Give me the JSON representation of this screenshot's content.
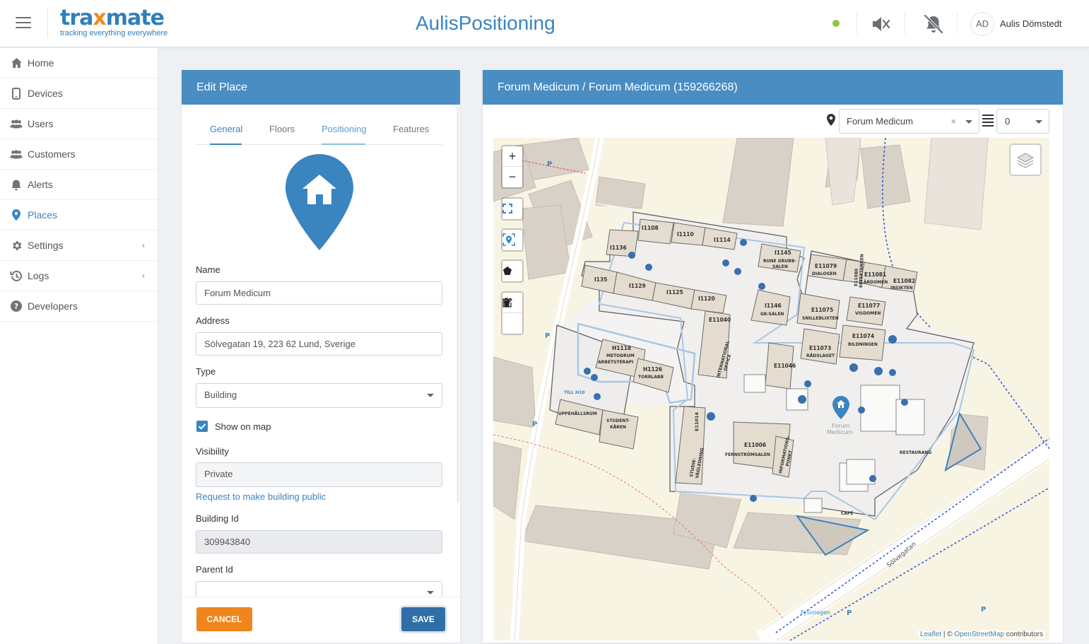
{
  "header": {
    "logo_brand_a": "tra",
    "logo_brand_x": "x",
    "logo_brand_b": "mate",
    "logo_tagline": "tracking everything everywhere",
    "app_title": "AulisPositioning",
    "user_initials": "AD",
    "user_name": "Aulis Dömstedt",
    "status_color": "#8dc63f"
  },
  "sidebar": {
    "items": [
      {
        "label": "Home",
        "icon": "home-icon"
      },
      {
        "label": "Devices",
        "icon": "phone-icon"
      },
      {
        "label": "Users",
        "icon": "users-icon"
      },
      {
        "label": "Customers",
        "icon": "customers-icon"
      },
      {
        "label": "Alerts",
        "icon": "bell-icon"
      },
      {
        "label": "Places",
        "icon": "map-pin-icon",
        "active": true
      },
      {
        "label": "Settings",
        "icon": "gear-icon",
        "expandable": true
      },
      {
        "label": "Logs",
        "icon": "history-icon",
        "expandable": true
      },
      {
        "label": "Developers",
        "icon": "help-icon"
      }
    ]
  },
  "edit_place": {
    "title": "Edit Place",
    "tabs": [
      "General",
      "Floors",
      "Positioning",
      "Features"
    ],
    "active_tab": "General",
    "name_label": "Name",
    "name_value": "Forum Medicum",
    "address_label": "Address",
    "address_value": "Sölvegatan 19, 223 62 Lund, Sverige",
    "type_label": "Type",
    "type_value": "Building",
    "show_on_map_label": "Show on map",
    "show_on_map": true,
    "visibility_label": "Visibility",
    "visibility_value": "Private",
    "request_public_link": "Request to make building public",
    "building_id_label": "Building Id",
    "building_id_value": "309943840",
    "parent_id_label": "Parent Id",
    "parent_id_value": "",
    "cancel_label": "CANCEL",
    "save_label": "SAVE"
  },
  "map_panel": {
    "title": "Forum Medicum / Forum Medicum (159266268)",
    "place_select": "Forum Medicum",
    "floor_select": "0",
    "street_label": "Sölvegatan",
    "poi_fysiologen": "Fysiologen",
    "marker_label": "Forum Medicum",
    "rooms": [
      "I1108",
      "I1110",
      "I1114",
      "I1136",
      "I1145",
      "RUNE GRUBB-SALEN",
      "E11079",
      "DIALOGEN",
      "E11080",
      "EFTERTANKEN",
      "E11081",
      "LÄRDOMEN",
      "E11082",
      "INSIKTEN",
      "I135",
      "I1129",
      "I1125",
      "I1120",
      "I1146",
      "GK-SALEN",
      "E11075",
      "SNILLEBLIXTEN",
      "E11077",
      "VISDOMEN",
      "E11040",
      "INTERNATIONAL OFFICE",
      "E11073",
      "RÅDSLAGET",
      "E11074",
      "BILDNINGEN",
      "E11046",
      "H1118",
      "METODRUM",
      "ARBETSTERAPI",
      "H1126",
      "TORRLABB",
      "TILL H10",
      "UPPEHÅLLSRUM",
      "STUDENT-KÅREN",
      "E11014",
      "STUDIE-VÄGLEDNING",
      "E11006",
      "FERNSTRÖMSALEN",
      "INFORMATIONS-PUNKT",
      "RESTAURANG",
      "CAFÉ"
    ],
    "attribution_leaflet": "Leaflet",
    "attribution_sep": " | © ",
    "attribution_osm": "OpenStreetMap",
    "attribution_tail": " contributors"
  }
}
